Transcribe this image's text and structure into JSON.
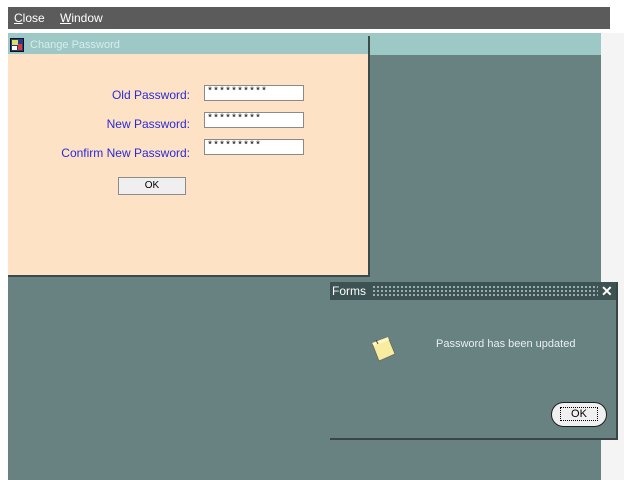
{
  "menu": {
    "items": [
      {
        "label_first": "C",
        "label_rest": "lose"
      },
      {
        "label_first": "W",
        "label_rest": "indow"
      }
    ]
  },
  "change_password": {
    "title": "Change Password",
    "fields": [
      {
        "label": "Old Password:",
        "value": "**********"
      },
      {
        "label": "New Password:",
        "value": "*********"
      },
      {
        "label": "Confirm New Password:",
        "value": "*********"
      }
    ],
    "ok_label": "OK"
  },
  "alert": {
    "title": "Forms",
    "close_glyph": "✕",
    "icon": "note-icon",
    "message": "Password has been updated",
    "ok_label": "OK"
  },
  "colors": {
    "menubar": "#5b5b5b",
    "workspace": "#688282",
    "form_background": "#fde2c6",
    "label_text": "#2b2bd6",
    "titlebar": "#9cc8c6"
  }
}
